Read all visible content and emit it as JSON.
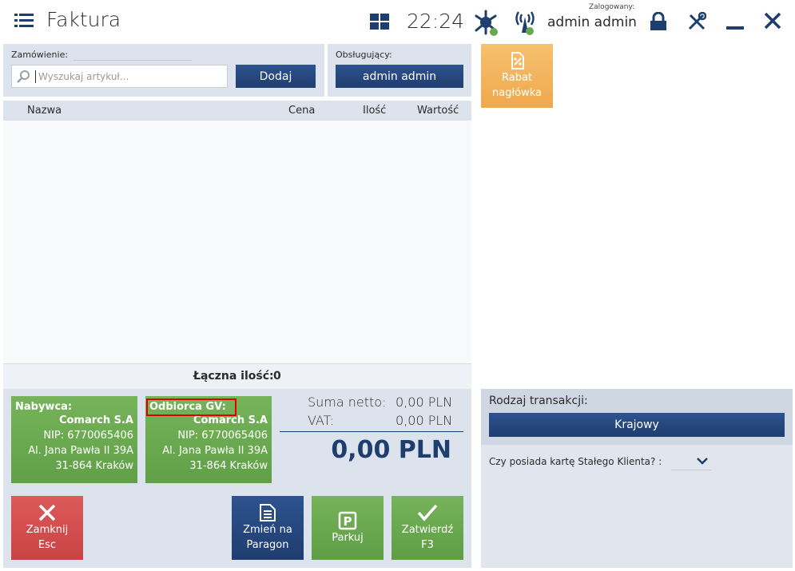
{
  "header": {
    "title": "Faktura",
    "clock": "22:24",
    "logged_label": "Zalogowany:",
    "user": "admin admin"
  },
  "order": {
    "label": "Zamówienie:",
    "search_placeholder": "Wyszukaj artykuł...",
    "add_button": "Dodaj"
  },
  "cashier": {
    "label": "Obsługujący:",
    "value": "admin admin"
  },
  "discount_tile": {
    "line1": "Rabat",
    "line2": "nagłówka"
  },
  "table": {
    "columns": [
      "Nazwa",
      "Cena",
      "Ilość",
      "Wartość"
    ],
    "total_qty_label": "Łączna ilość:",
    "total_qty_value": "0"
  },
  "buyer": {
    "title": "Nabywca:",
    "name": "Comarch S.A",
    "nip": "NIP: 6770065406",
    "street": "Al. Jana Pawła II 39A",
    "city": "31-864 Kraków"
  },
  "receiver": {
    "title": "Odbiorca GV:",
    "name": "Comarch S.A",
    "nip": "NIP: 6770065406",
    "street": "Al. Jana Pawła II 39A",
    "city": "31-864 Kraków"
  },
  "summary": {
    "net_label": "Suma netto:",
    "net_value": "0,00 PLN",
    "vat_label": "VAT:",
    "vat_value": "0,00 PLN",
    "total": "0,00 PLN"
  },
  "actions": {
    "close_l1": "Zamknij",
    "close_l2": "Esc",
    "change_l1": "Zmień na",
    "change_l2": "Paragon",
    "park": "Parkuj",
    "confirm_l1": "Zatwierdź",
    "confirm_l2": "F3"
  },
  "transaction": {
    "label": "Rodzaj transakcji:",
    "value": "Krajowy",
    "loyalty_label": "Czy posiada kartę Stałego Klienta? :"
  },
  "colors": {
    "navy": "#1f3d6f",
    "green": "#6aa84f",
    "red": "#c84444",
    "orange": "#f3b15a",
    "panel": "#dde3ec",
    "highlight": "#e00000"
  }
}
